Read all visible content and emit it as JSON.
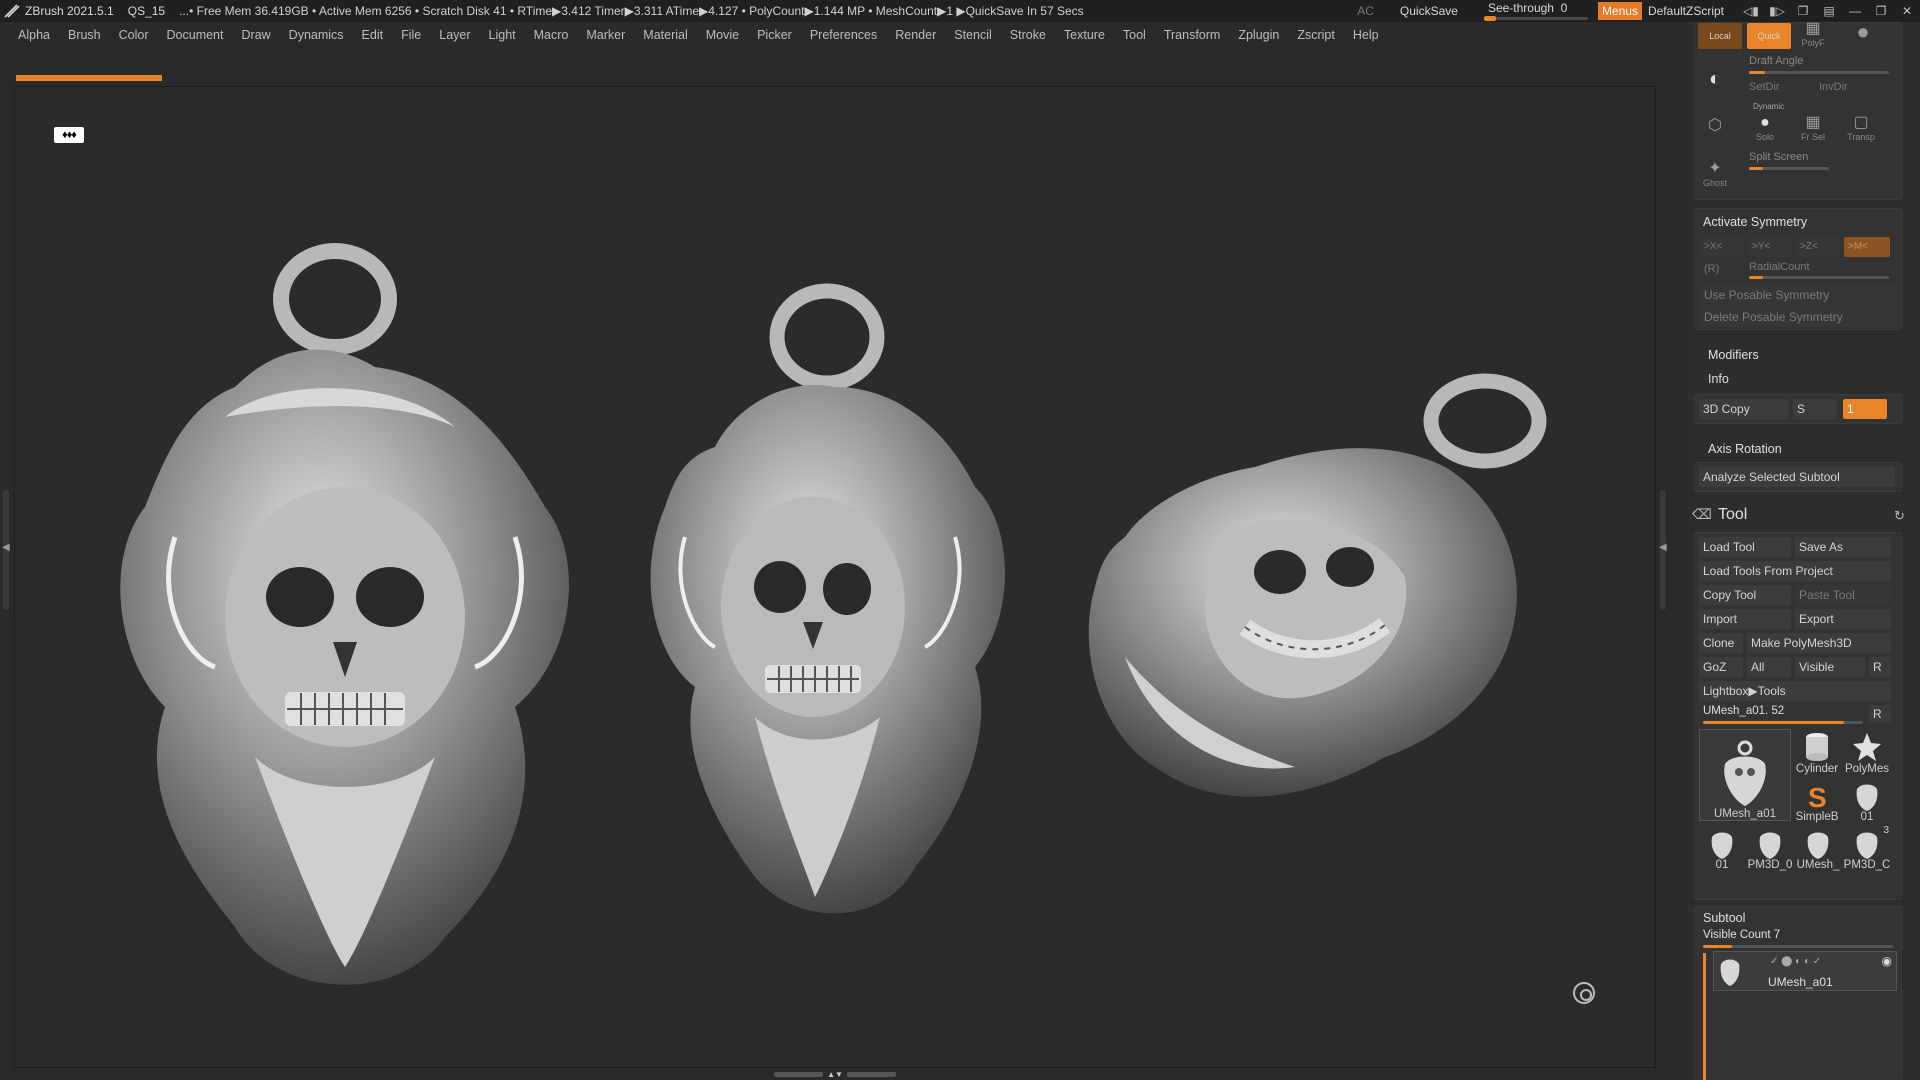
{
  "titlebar": {
    "app": "ZBrush 2021.5.1",
    "document": "QS_15",
    "stats": "...• Free Mem 36.419GB • Active Mem 6256 • Scratch Disk 41 • RTime▶3.412 Timer▶3.311 ATime▶4.127 • PolyCount▶1.144 MP • MeshCount▶1 ▶QuickSave In 57 Secs",
    "ac": "AC",
    "quicksave": "QuickSave",
    "see_through_label": "See-through",
    "see_through_value": "0",
    "menus": "Menus",
    "default_zscript": "DefaultZScript",
    "accent": "#e8842a"
  },
  "menubar": [
    "Alpha",
    "Brush",
    "Color",
    "Document",
    "Draw",
    "Dynamics",
    "Edit",
    "File",
    "Layer",
    "Light",
    "Macro",
    "Marker",
    "Material",
    "Movie",
    "Picker",
    "Preferences",
    "Render",
    "Stencil",
    "Stroke",
    "Texture",
    "Tool",
    "Transform",
    "Zplugin",
    "Zscript",
    "Help"
  ],
  "canvas": {
    "badge": "♦♦♦",
    "objects": [
      "skull-pendant-front",
      "skull-pendant-three-quarter",
      "skull-pendant-side"
    ]
  },
  "tray": {
    "top_icons": {
      "local": "Local",
      "quick": "Quick",
      "polyf": "PolyF",
      "draft_angle": "Draft Angle",
      "setdir": "SetDir",
      "invdir": "InvDir",
      "dynamic": "Dynamic",
      "solo": "Solo",
      "frsel": "Fr Sel",
      "transp": "Transp",
      "split_screen": "Split Screen",
      "ghost": "Ghost"
    },
    "symmetry": {
      "title": "Activate Symmetry",
      "x": ">X<",
      "y": ">Y<",
      "z": ">Z<",
      "m": ">M<",
      "r": "(R)",
      "radial_count": "RadialCount",
      "use_posable": "Use Posable Symmetry",
      "delete_posable": "Delete Posable Symmetry"
    },
    "modifiers": "Modifiers",
    "info": "Info",
    "copy3d": {
      "label": "3D Copy",
      "s": "S",
      "value": "1"
    },
    "axis_rotation": "Axis Rotation",
    "analyze": "Analyze Selected Subtool",
    "tool": {
      "title": "Tool",
      "load_tool": "Load Tool",
      "save_as": "Save As",
      "load_from_project": "Load Tools From Project",
      "copy_tool": "Copy Tool",
      "paste_tool": "Paste Tool",
      "import": "Import",
      "export": "Export",
      "clone": "Clone",
      "make_polymesh": "Make PolyMesh3D",
      "goz": "GoZ",
      "all": "All",
      "visible": "Visible",
      "r": "R",
      "lightbox": "Lightbox▶Tools",
      "current_tool": "UMesh_a01. 52",
      "current_r": "R",
      "current_level": 0.88,
      "thumbs": [
        "UMesh_a01",
        "Cylinder",
        "PolyMes",
        "SimpleB",
        "01",
        "01",
        "PM3D_0",
        "UMesh_",
        "PM3D_C"
      ],
      "thumb_badges": [
        "",
        "",
        "",
        "",
        "",
        "",
        "",
        "",
        "3"
      ]
    },
    "subtool": {
      "title": "Subtool",
      "visible_count": "Visible Count 7",
      "visible_count_level": 0.15,
      "item_name": "UMesh_a01"
    }
  }
}
